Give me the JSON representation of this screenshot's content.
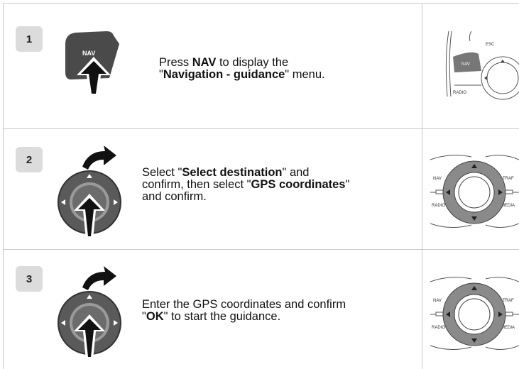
{
  "steps": [
    {
      "number": "1",
      "button_label": "NAV",
      "instruction": [
        {
          "t": "Press ",
          "b": false
        },
        {
          "t": "NAV",
          "b": true
        },
        {
          "t": " to display the\n\"",
          "b": false
        },
        {
          "t": "Navigation - guidance",
          "b": true
        },
        {
          "t": "\" menu.",
          "b": false
        }
      ],
      "panel_labels": {
        "nav": "NAV",
        "esc": "ESC",
        "radio": "RADIO"
      }
    },
    {
      "number": "2",
      "instruction": [
        {
          "t": "Select \"",
          "b": false
        },
        {
          "t": "Select destination",
          "b": true
        },
        {
          "t": "\" and\nconfirm, then select \"",
          "b": false
        },
        {
          "t": "GPS coordinates",
          "b": true
        },
        {
          "t": "\"\nand confirm.",
          "b": false
        }
      ],
      "panel_labels": {
        "nav": "NAV",
        "traf": "TRAF",
        "radio": "RADIO",
        "media": "MEDIA"
      }
    },
    {
      "number": "3",
      "instruction": [
        {
          "t": "Enter the GPS coordinates and confirm\n\"",
          "b": false
        },
        {
          "t": "OK",
          "b": true
        },
        {
          "t": "\" to start the guidance.",
          "b": false
        }
      ],
      "panel_labels": {
        "nav": "NAV",
        "traf": "TRAF",
        "radio": "RADIO",
        "media": "MEDIA"
      }
    }
  ]
}
